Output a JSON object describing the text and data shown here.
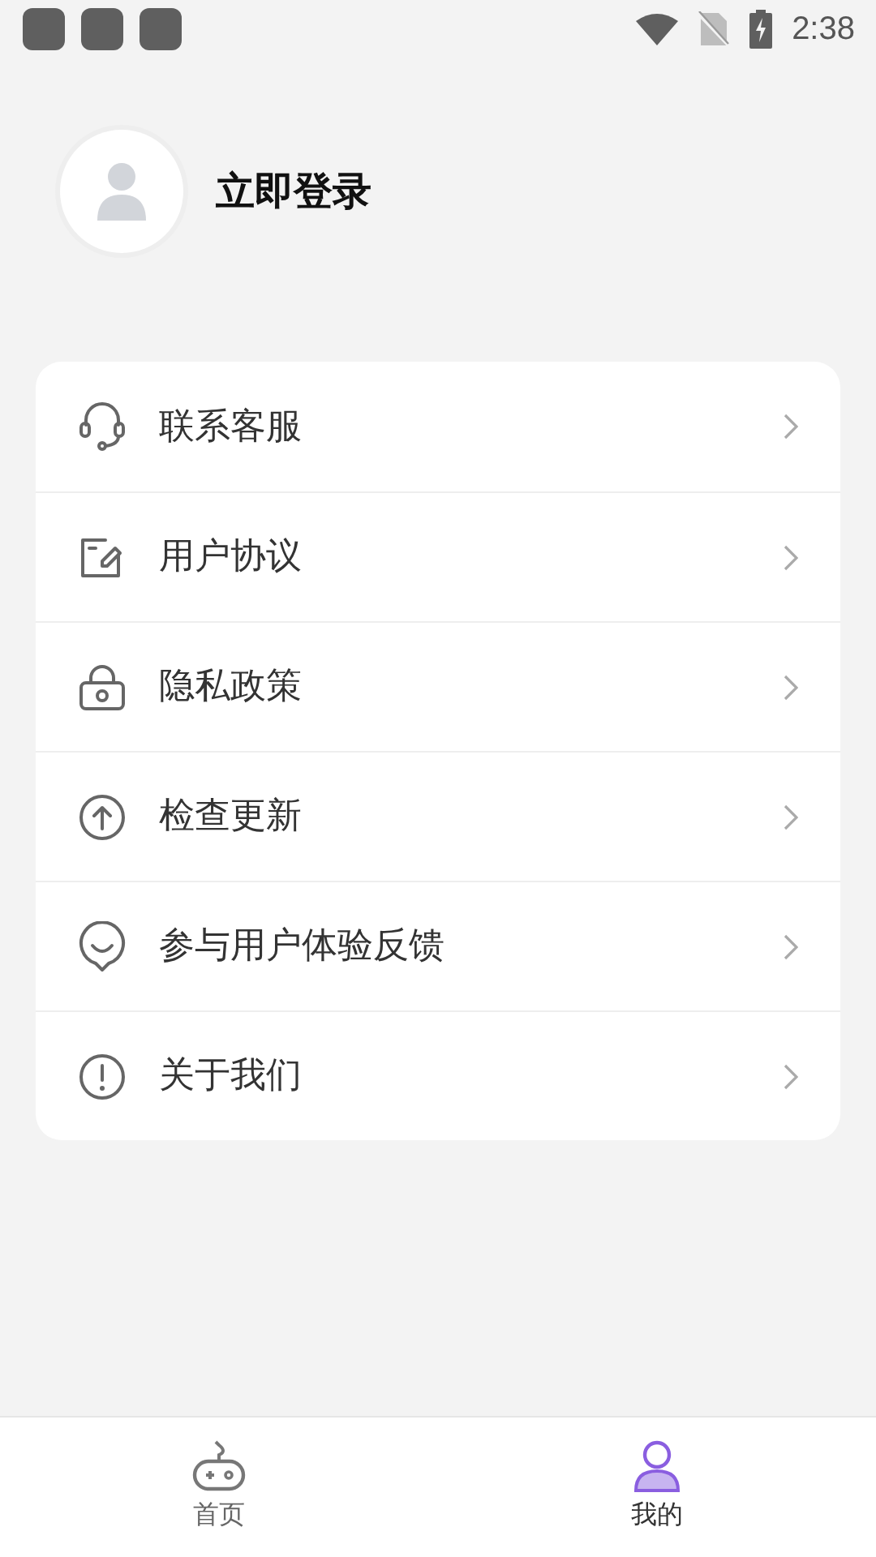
{
  "status_bar": {
    "time": "2:38"
  },
  "profile": {
    "login_label": "立即登录"
  },
  "menu": [
    {
      "label": "联系客服"
    },
    {
      "label": "用户协议"
    },
    {
      "label": "隐私政策"
    },
    {
      "label": "检查更新"
    },
    {
      "label": "参与用户体验反馈"
    },
    {
      "label": "关于我们"
    }
  ],
  "tab_bar": [
    {
      "label": "首页",
      "selected": false
    },
    {
      "label": "我的",
      "selected": true
    }
  ]
}
